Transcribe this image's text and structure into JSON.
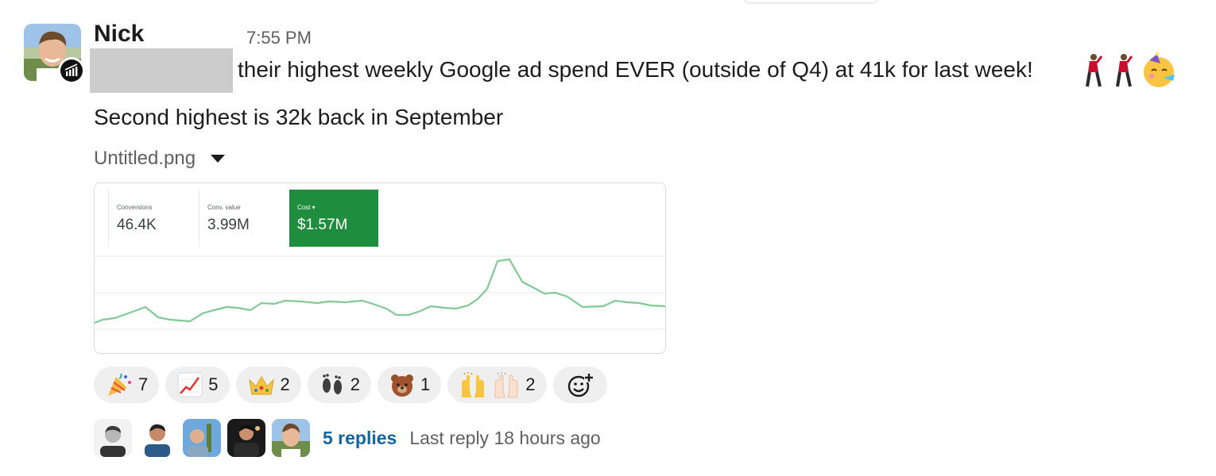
{
  "message": {
    "sender": "Nick",
    "time": "7:55 PM",
    "line1": "their highest weekly Google ad spend EVER (outside of Q4) at 41k for last week!",
    "line2": "Second highest is 32k back in September",
    "trailing_emojis": [
      "dancing-man-icon",
      "dancing-man-icon",
      "partying-face-icon"
    ]
  },
  "attachment": {
    "file_name": "Untitled.png",
    "metrics": [
      {
        "label": "Conversions",
        "value": "46.4K"
      },
      {
        "label": "Conv. value",
        "value": "3.99M"
      },
      {
        "label": "Cost ▾",
        "value": "$1.57M"
      }
    ],
    "line_color": "#81c995",
    "active_color": "#1e8e3e"
  },
  "reactions": [
    {
      "icon": "party-popper-icon",
      "count": "7"
    },
    {
      "icon": "chart-increasing-icon",
      "count": "5"
    },
    {
      "icon": "crown-icon",
      "count": "2"
    },
    {
      "icon": "footprints-icon",
      "count": "2"
    },
    {
      "icon": "bear-icon",
      "count": "1"
    },
    {
      "icon": "raised-hands-icon",
      "count": "2"
    }
  ],
  "add_reaction_icon": "add-reaction-icon",
  "thread": {
    "replies": "5 replies",
    "last_reply": "Last reply 18 hours ago"
  },
  "colors": {
    "link": "#1264a3",
    "pill_bg": "#efefef",
    "muted_text": "#616061"
  }
}
